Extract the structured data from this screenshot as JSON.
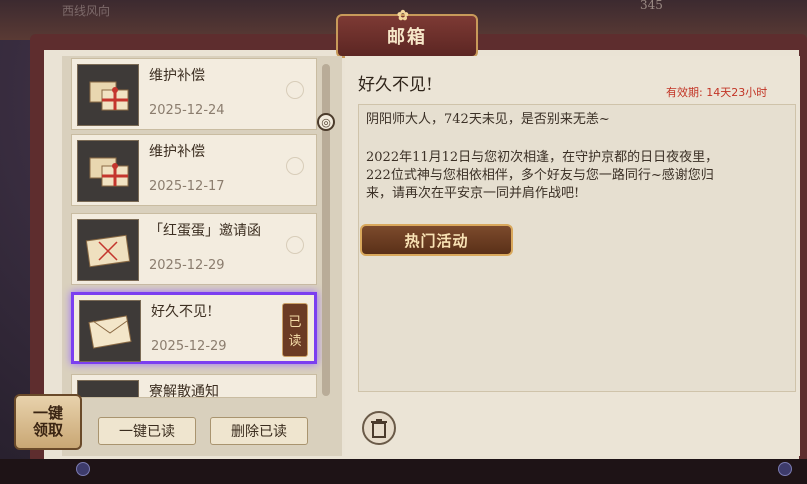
{
  "window": {
    "title": "邮箱",
    "top_ghost_left": "西线风向",
    "top_ghost_right": "345"
  },
  "mails": [
    {
      "title": "维护补偿",
      "date": "2025-12-24",
      "icon": "gift-package-icon"
    },
    {
      "title": "维护补偿",
      "date": "2025-12-17",
      "icon": "gift-package-icon"
    },
    {
      "title": "「红蛋蛋」邀请函",
      "date": "2025-12-29",
      "icon": "envelope-icon"
    },
    {
      "title": "好久不见!",
      "date": "2025-12-29",
      "icon": "open-letter-icon",
      "tag": [
        "已",
        "读"
      ]
    },
    {
      "title": "寮解散通知",
      "date": "",
      "icon": "envelope-icon"
    }
  ],
  "buttons": {
    "read_all": "一键已读",
    "delete_read": "删除已读",
    "claim_all": [
      "一键",
      "领取"
    ]
  },
  "detail": {
    "title": "好久不见!",
    "expiry": "有效期: 14天23小时",
    "para1": "阴阳师大人，742天未见，是否别来无恙~",
    "para2_line1": "2022年11月12日与您初次相逢，在守护京都的日日夜夜里，",
    "para2_line2": "222位式神与您相依相伴，多个好友与您一路同行~感谢您归",
    "para2_line3": "来，请再次在平安京一同并肩作战吧!",
    "button": "热门活动"
  },
  "colors": {
    "accent_purple": "#7b3ef0",
    "expiry_red": "#c23425",
    "frame_brown": "#5e2d2e"
  }
}
